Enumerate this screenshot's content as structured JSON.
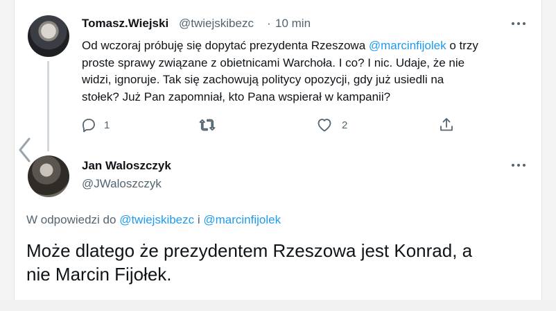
{
  "parent_tweet": {
    "author_name": "Tomasz.Wiejski",
    "author_handle": "@twiejskibezc",
    "separator": "·",
    "time": "10 min",
    "text_lines": [
      {
        "pre": "Od wczoraj próbuję się dopytać prezydenta Rzeszowa ",
        "mention": "@marcinfijolek",
        "post": " o trzy"
      },
      {
        "pre": "proste sprawy związane z obietnicami Warchoła. I co? I nic. Udaje, że nie"
      },
      {
        "pre": "widzi, ignoruje. Tak się zachowują politycy opozycji, gdy już usiedli na"
      },
      {
        "pre": "stołek? Już Pan zapomniał, kto Pana wspierał w kampanii?"
      }
    ],
    "actions": {
      "reply_count": "1",
      "retweet_count": "",
      "like_count": "2"
    }
  },
  "reply_tweet": {
    "author_name": "Jan Waloszczyk",
    "author_handle": "@JWaloszczyk",
    "replying_to": {
      "prefix": "W odpowiedzi do ",
      "mention1": "@twiejskibezc",
      "joiner": " i ",
      "mention2": "@marcinfijolek"
    },
    "text_lines": [
      "Może dlatego że prezydentem Rzeszowa jest Konrad, a",
      "nie Marcin Fijołek."
    ]
  },
  "colors": {
    "accent": "#1d9bf0",
    "text": "#0f1419",
    "secondary": "#536471",
    "thread_line": "#cfd9de"
  },
  "icons": [
    "more-icon",
    "reply-icon",
    "retweet-icon",
    "like-icon",
    "share-icon",
    "chevron-left-icon"
  ]
}
